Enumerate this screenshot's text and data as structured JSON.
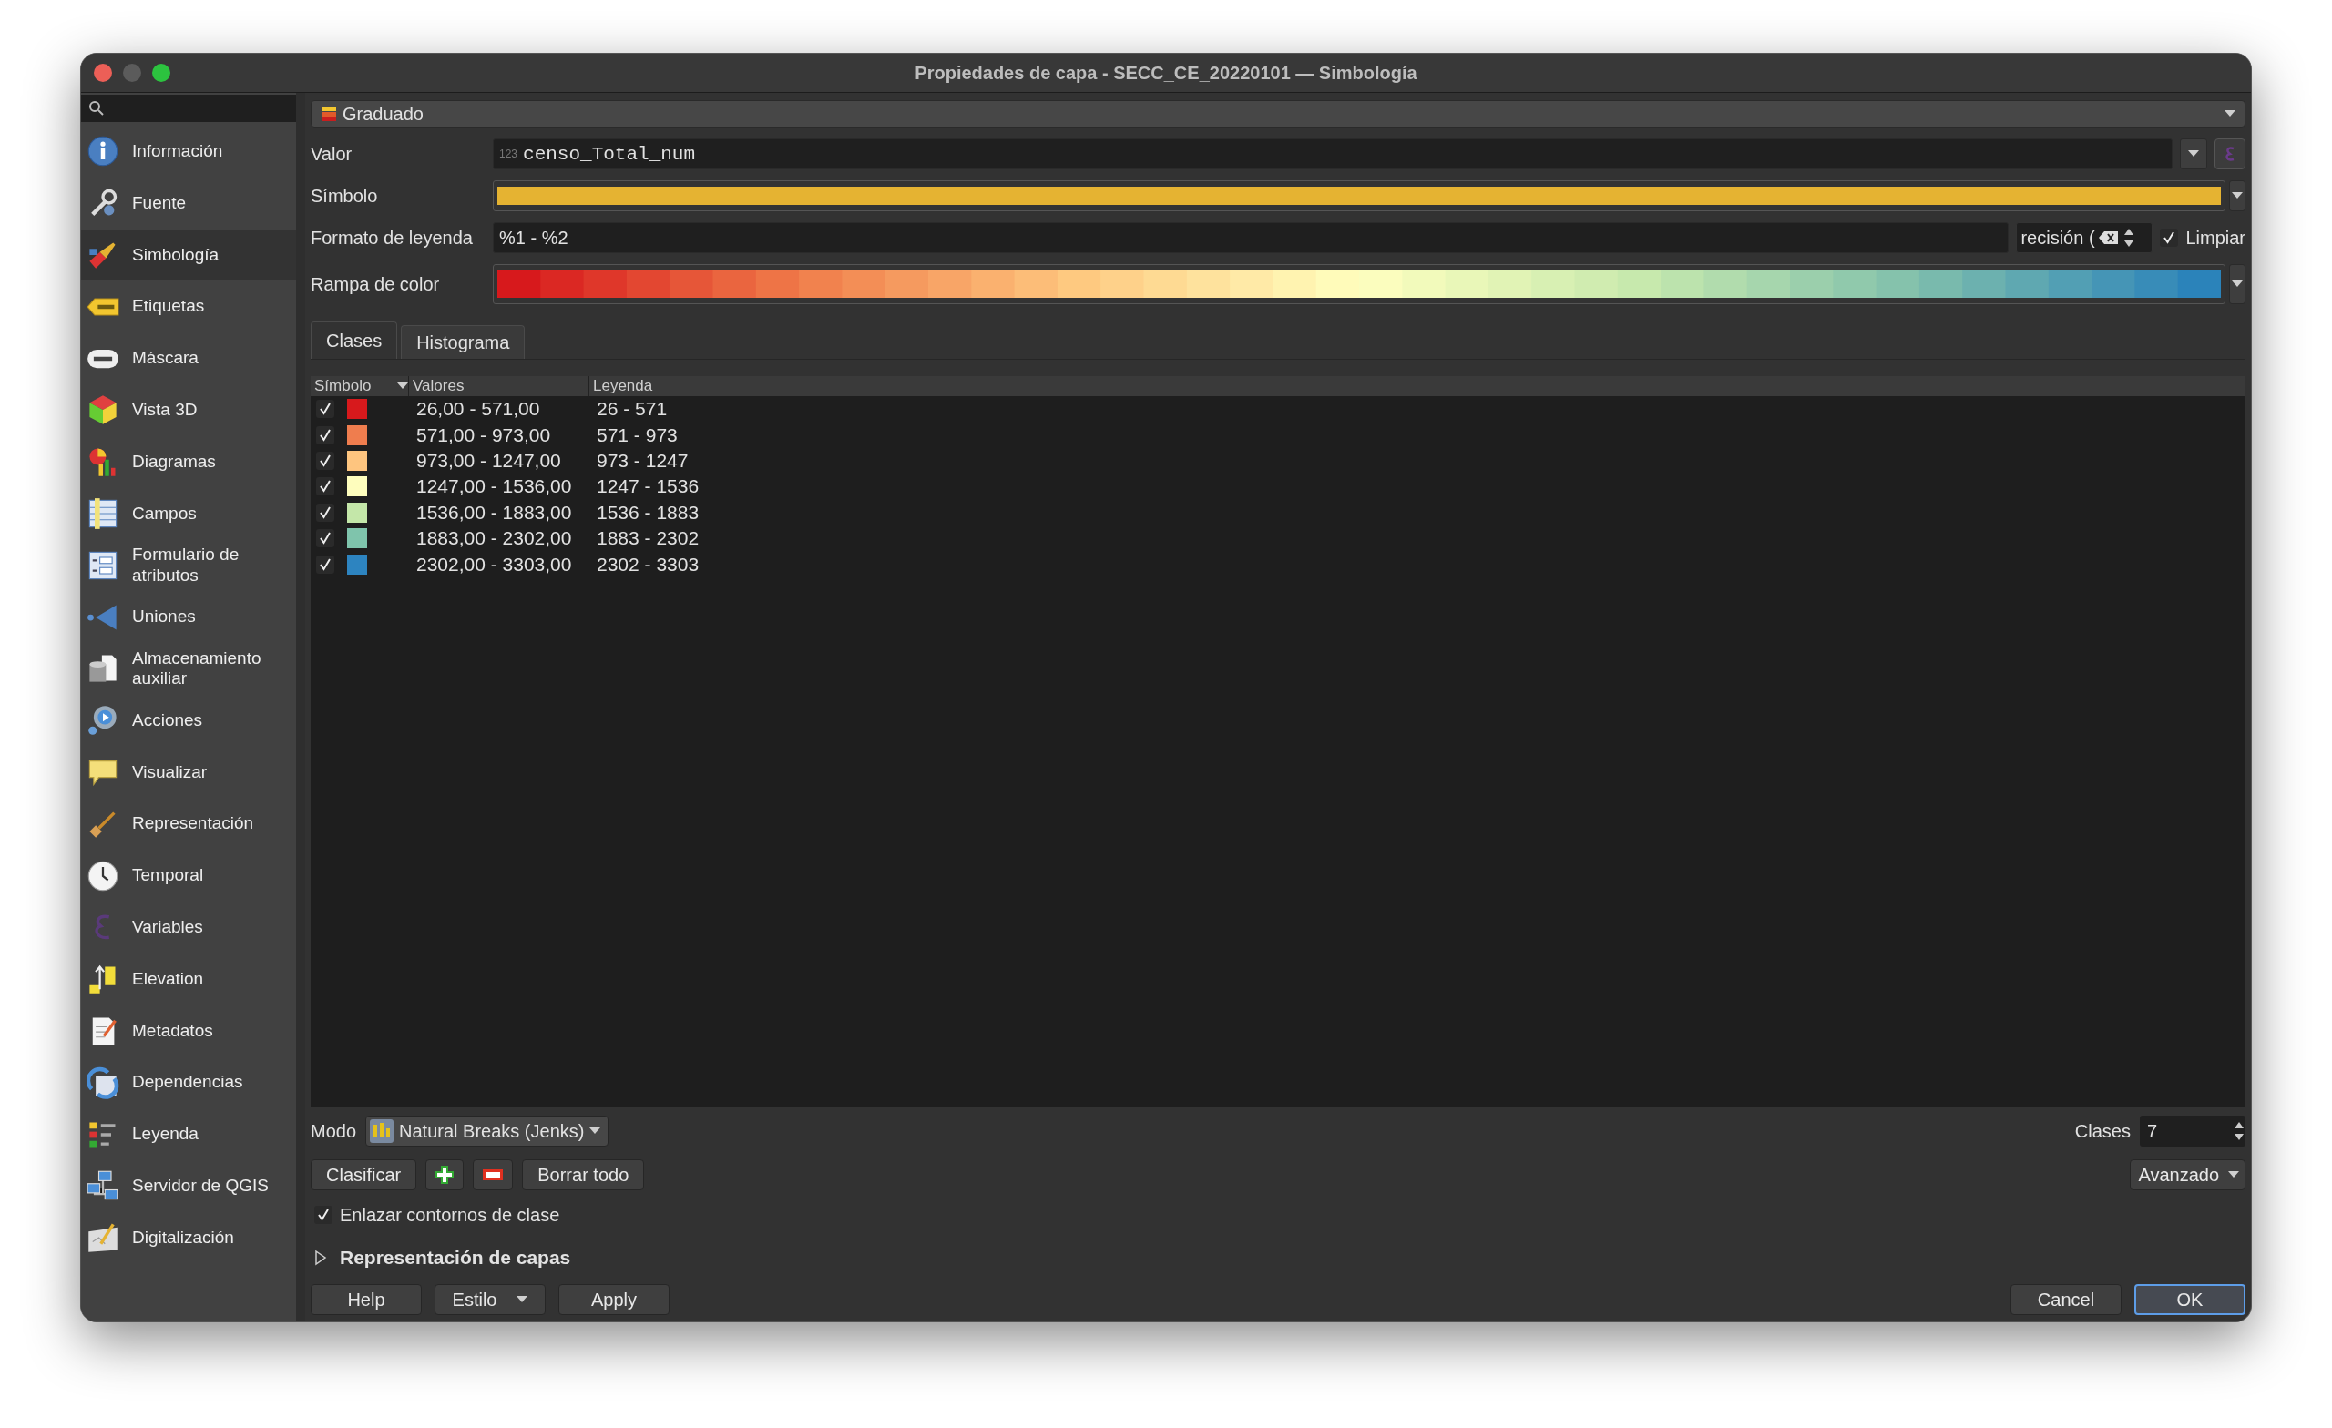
{
  "window": {
    "title": "Propiedades de capa - SECC_CE_20220101 — Simbología"
  },
  "sidebar": {
    "items": [
      {
        "label": "Información",
        "selected": false
      },
      {
        "label": "Fuente",
        "selected": false
      },
      {
        "label": "Simbología",
        "selected": true
      },
      {
        "label": "Etiquetas",
        "selected": false
      },
      {
        "label": "Máscara",
        "selected": false
      },
      {
        "label": "Vista 3D",
        "selected": false
      },
      {
        "label": "Diagramas",
        "selected": false
      },
      {
        "label": "Campos",
        "selected": false
      },
      {
        "label": "Formulario de atributos",
        "selected": false
      },
      {
        "label": "Uniones",
        "selected": false
      },
      {
        "label": "Almacenamiento auxiliar",
        "selected": false
      },
      {
        "label": "Acciones",
        "selected": false
      },
      {
        "label": "Visualizar",
        "selected": false
      },
      {
        "label": "Representación",
        "selected": false
      },
      {
        "label": "Temporal",
        "selected": false
      },
      {
        "label": "Variables",
        "selected": false
      },
      {
        "label": "Elevation",
        "selected": false
      },
      {
        "label": "Metadatos",
        "selected": false
      },
      {
        "label": "Dependencias",
        "selected": false
      },
      {
        "label": "Leyenda",
        "selected": false
      },
      {
        "label": "Servidor de QGIS",
        "selected": false
      },
      {
        "label": "Digitalización",
        "selected": false
      }
    ]
  },
  "renderer": {
    "value": "Graduado"
  },
  "form": {
    "value_label": "Valor",
    "value_type": "123",
    "value_field": "censo_Total_num",
    "symbol_label": "Símbolo",
    "legend_format_label": "Formato de leyenda",
    "legend_format": "%1 - %2",
    "precision": "recisión (",
    "trim": {
      "label": "Limpiar",
      "checked": true
    },
    "color_ramp_label": "Rampa de color"
  },
  "tabs": [
    {
      "label": "Clases",
      "selected": true
    },
    {
      "label": "Histograma",
      "selected": false
    }
  ],
  "classes": {
    "columns": [
      "Símbolo",
      "Valores",
      "Leyenda"
    ],
    "rows": [
      {
        "checked": true,
        "color": "#d7191c",
        "values": "26,00 - 571,00",
        "legend": "26 - 571"
      },
      {
        "checked": true,
        "color": "#ef7d4e",
        "values": "571,00 - 973,00",
        "legend": "571 - 973"
      },
      {
        "checked": true,
        "color": "#fec57f",
        "values": "973,00 - 1247,00",
        "legend": "973 - 1247"
      },
      {
        "checked": true,
        "color": "#fefdbd",
        "values": "1247,00 - 1536,00",
        "legend": "1247 - 1536"
      },
      {
        "checked": true,
        "color": "#c4e7a9",
        "values": "1536,00 - 1883,00",
        "legend": "1536 - 1883"
      },
      {
        "checked": true,
        "color": "#7fc4ac",
        "values": "1883,00 - 2302,00",
        "legend": "1883 - 2302"
      },
      {
        "checked": true,
        "color": "#2d84c0",
        "values": "2302,00 - 3303,00",
        "legend": "2302 - 3303"
      }
    ]
  },
  "mode": {
    "label": "Modo",
    "value": "Natural Breaks (Jenks)"
  },
  "class_count": {
    "label": "Clases",
    "value": "7"
  },
  "actions": {
    "classify": "Clasificar",
    "delete_all": "Borrar todo",
    "advanced": "Avanzado"
  },
  "link_boundaries": {
    "label": "Enlazar contornos de clase",
    "checked": true
  },
  "layer_rendering": {
    "label": "Representación de capas",
    "expanded": false
  },
  "footer": {
    "left": [
      {
        "label": "Help",
        "kind": "plain"
      },
      {
        "label": "Estilo",
        "kind": "menu"
      },
      {
        "label": "Apply",
        "kind": "plain"
      }
    ],
    "right": [
      {
        "label": "Cancel",
        "kind": "plain"
      },
      {
        "label": "OK",
        "kind": "default"
      }
    ]
  }
}
